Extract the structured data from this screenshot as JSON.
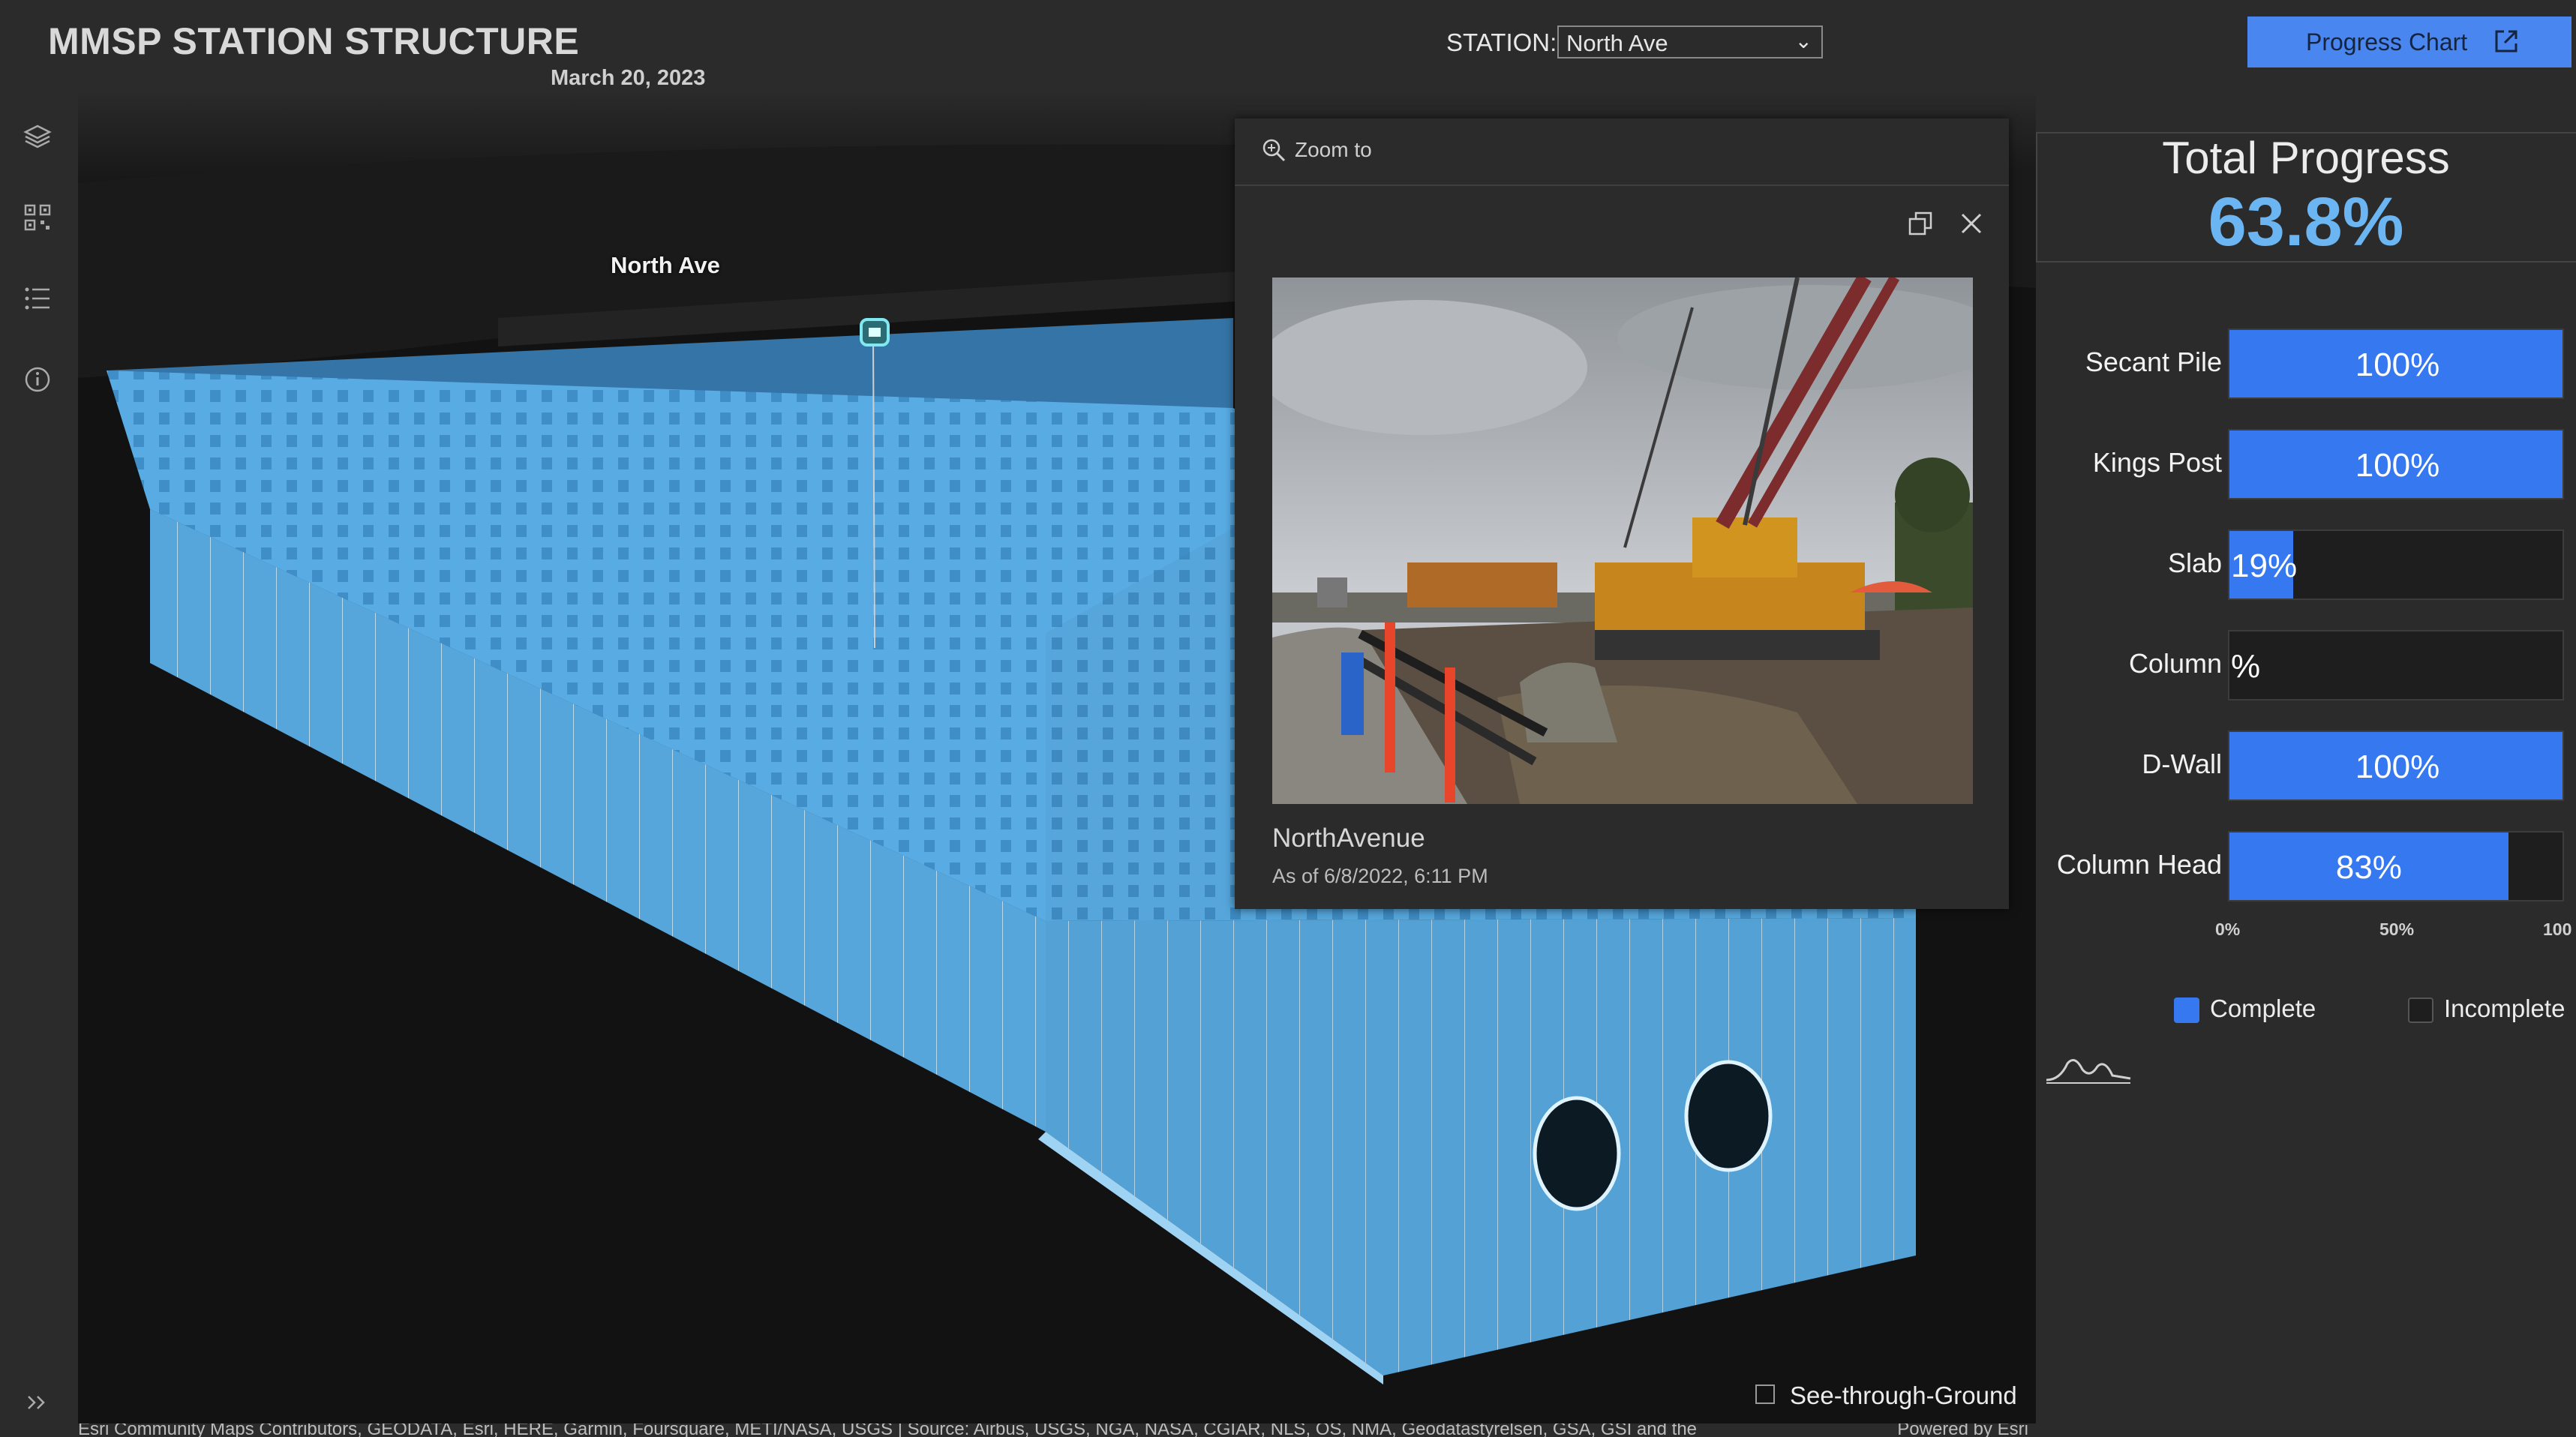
{
  "header": {
    "title": "MMSP STATION STRUCTURE",
    "date": "March 20, 2023",
    "station_label": "STATION:",
    "station_value": "North Ave",
    "progress_chart_label": "Progress Chart"
  },
  "rail": {
    "icons": [
      "layers-icon",
      "qr-grid-icon",
      "list-icon",
      "info-icon",
      "expand-chevrons-icon"
    ]
  },
  "map": {
    "place_label": "North Ave",
    "see_through_label": "See-through-Ground",
    "see_through_checked": false,
    "attribution": "Esri Community Maps Contributors, GEODATA, Esri, HERE, Garmin, Foursquare, METI/NASA, USGS | Source: Airbus, USGS, NGA, NASA, CGIAR, NLS, OS, NMA, Geodatastyrelsen, GSA, GSI and the",
    "powered_by": "Powered by Esri",
    "colors": {
      "structure": "#5aaee6",
      "ground": "#151515"
    }
  },
  "popup": {
    "zoom_label": "Zoom to",
    "photo_title": "NorthAvenue",
    "photo_date": "As of 6/8/2022, 6:11 PM"
  },
  "progress": {
    "total_label": "Total Progress",
    "total_value": "63.8%",
    "items": [
      {
        "label": "Secant Pile",
        "value_text": "100%",
        "fraction": 1.0
      },
      {
        "label": "Kings Post",
        "value_text": "100%",
        "fraction": 1.0
      },
      {
        "label": "Slab",
        "value_text": "19%",
        "fraction": 0.19
      },
      {
        "label": "Column",
        "value_text": "%",
        "fraction": 0.0
      },
      {
        "label": "D-Wall",
        "value_text": "100%",
        "fraction": 1.0
      },
      {
        "label": "Column Head",
        "value_text": "83%",
        "fraction": 0.83
      }
    ],
    "ticks": [
      "0%",
      "50%",
      "100"
    ],
    "legend": {
      "complete": "Complete",
      "incomplete": "Incomplete"
    },
    "colors": {
      "complete": "#3578f0",
      "incomplete": "#1e1e1e",
      "total": "#6bb6f2"
    }
  }
}
